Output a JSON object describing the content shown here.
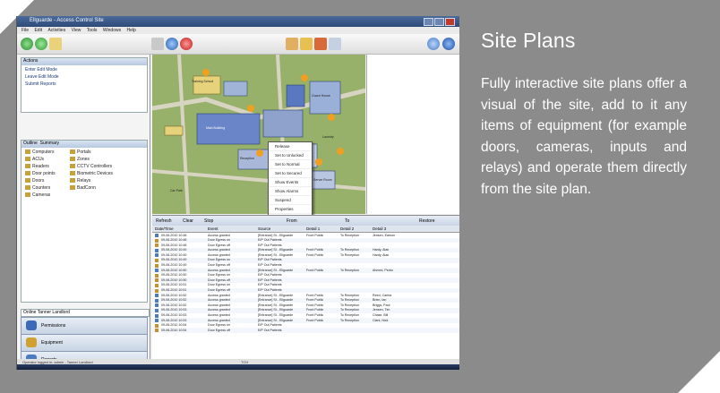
{
  "card": {
    "background": "#8b8b8b",
    "text_color": "#ffffff"
  },
  "title": "Site Plans",
  "description": "Fully interactive site plans offer a visual of the site, add to it any items of equipment (for example doors, cameras, inputs and relays) and operate them directly from the site plan.",
  "screenshot": {
    "window_title": "Ellguarde - Access Control Site",
    "menu": [
      "File",
      "Edit",
      "Activities",
      "View",
      "Tools",
      "Windows",
      "Help"
    ],
    "actions_panel": {
      "header": "Actions",
      "items": [
        "Enter Edit Mode",
        "Leave Edit Mode",
        "Submit Reports"
      ]
    },
    "outline_tabs": [
      "Outline",
      "Summary"
    ],
    "equipment_icons": [
      "Computers",
      "ACUs",
      "Readers",
      "Door points",
      "Doors",
      "Counters",
      "Cameras",
      "Portals",
      "Zones",
      "CCTV Controllers",
      "Biometric Devices",
      "Relays",
      "BadConn"
    ],
    "site_selector": "Online Tanner Landlord",
    "nav_buttons": [
      "Permissions",
      "Equipment",
      "Reports"
    ],
    "map_labels": [
      "Training School",
      "Main Building",
      "Reception",
      "Guard House",
      "Car Park",
      "Laundry",
      "Server Room"
    ],
    "context_menu": [
      "Release",
      "Set to Unlocked",
      "Set to Normal",
      "Set to Secured",
      "Show Events",
      "Show Alarms",
      "Suspend",
      "Properties"
    ],
    "events_toolbar": [
      "Refresh",
      "Clear",
      "Stop",
      "From",
      "To",
      "Restore"
    ],
    "events_columns": [
      "Date/Time",
      "Event",
      "Source",
      "Detail 1",
      "Detail 2",
      "Detail 3"
    ],
    "events_rows": [
      [
        "09-06-2010 10:48",
        "Access granted",
        "[Entrance] St - Ellguarde",
        "Front Public",
        "To Reception",
        "Jensen, Eamon"
      ],
      [
        "09-06-2010 10:48",
        "Door Egress on",
        "E/P Out Patients",
        "",
        "",
        ""
      ],
      [
        "09-06-2010 10:48",
        "Door Egress off",
        "E/P Out Patients",
        "",
        "",
        ""
      ],
      [
        "09-06-2010 10:49",
        "Access granted",
        "[Entrance] St - Ellguarde",
        "Front Public",
        "To Reception",
        "Hardy, Alan"
      ],
      [
        "09-06-2010 10:49",
        "Access granted",
        "[Entrance] St - Ellguarde",
        "Front Public",
        "To Reception",
        "Hardy, Alan"
      ],
      [
        "09-06-2010 10:49",
        "Door Egress on",
        "E/P Out Patients",
        "",
        "",
        ""
      ],
      [
        "09-06-2010 10:49",
        "Door Egress off",
        "E/P Out Patients",
        "",
        "",
        ""
      ],
      [
        "09-06-2010 10:50",
        "Access granted",
        "[Entrance] St - Ellguarde",
        "Front Public",
        "To Reception",
        "Ahmed, Pedro"
      ],
      [
        "09-06-2010 10:50",
        "Door Egress on",
        "E/P Out Patients",
        "",
        "",
        ""
      ],
      [
        "09-06-2010 10:50",
        "Door Egress off",
        "E/P Out Patients",
        "",
        "",
        ""
      ],
      [
        "09-06-2010 10:51",
        "Door Egress on",
        "E/P Out Patients",
        "",
        "",
        ""
      ],
      [
        "09-06-2010 10:51",
        "Door Egress off",
        "E/P Out Patients",
        "",
        "",
        ""
      ],
      [
        "09-06-2010 10:52",
        "Access granted",
        "[Entrance] St - Ellguarde",
        "Front Public",
        "To Reception",
        "Reed, Carina"
      ],
      [
        "09-06-2010 10:52",
        "Access granted",
        "[Entrance] St - Ellguarde",
        "Front Public",
        "To Reception",
        "Brien, Ian"
      ],
      [
        "09-06-2010 10:52",
        "Access granted",
        "[Entrance] St - Ellguarde",
        "Front Public",
        "To Reception",
        "Briggs, Paul"
      ],
      [
        "09-06-2010 10:53",
        "Access granted",
        "[Entrance] St - Ellguarde",
        "Front Public",
        "To Reception",
        "Jensen, Tim"
      ],
      [
        "09-06-2010 10:53",
        "Access granted",
        "[Entrance] St - Ellguarde",
        "Front Public",
        "To Reception",
        "Chase, Bill"
      ],
      [
        "09-06-2010 10:53",
        "Access granted",
        "[Entrance] St - Ellguarde",
        "Front Public",
        "To Reception",
        "Clark, Nick"
      ],
      [
        "09-06-2010 10:54",
        "Door Egress on",
        "E/P Out Patients",
        "",
        "",
        ""
      ],
      [
        "09-06-2010 10:54",
        "Door Egress off",
        "E/P Out Patients",
        "",
        "",
        ""
      ]
    ],
    "status_text": "Operator logged in: admin - Tanner Landlord",
    "status_right": "TCH"
  }
}
